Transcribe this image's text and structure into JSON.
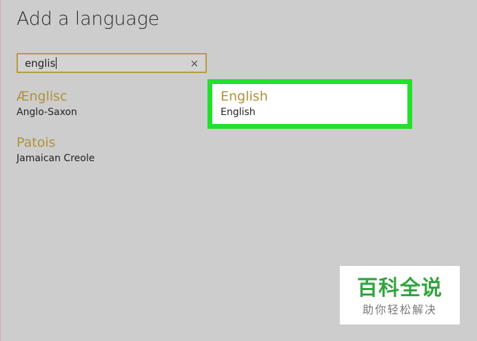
{
  "page": {
    "title": "Add a language"
  },
  "search": {
    "value": "englis",
    "clear_icon": "close-icon",
    "clear_glyph": "×"
  },
  "languages": [
    {
      "name": "Ænglisc",
      "native": "Anglo-Saxon"
    },
    {
      "name": "English",
      "native": "English",
      "highlighted": true
    },
    {
      "name": "Patois",
      "native": "Jamaican Creole"
    }
  ],
  "watermark": {
    "title": "百科全说",
    "subtitle": "助你轻松解决"
  },
  "colors": {
    "background": "#cdcdcd",
    "accent": "#b0913a",
    "highlight": "#22e02c",
    "watermark_green": "#31a53e"
  }
}
